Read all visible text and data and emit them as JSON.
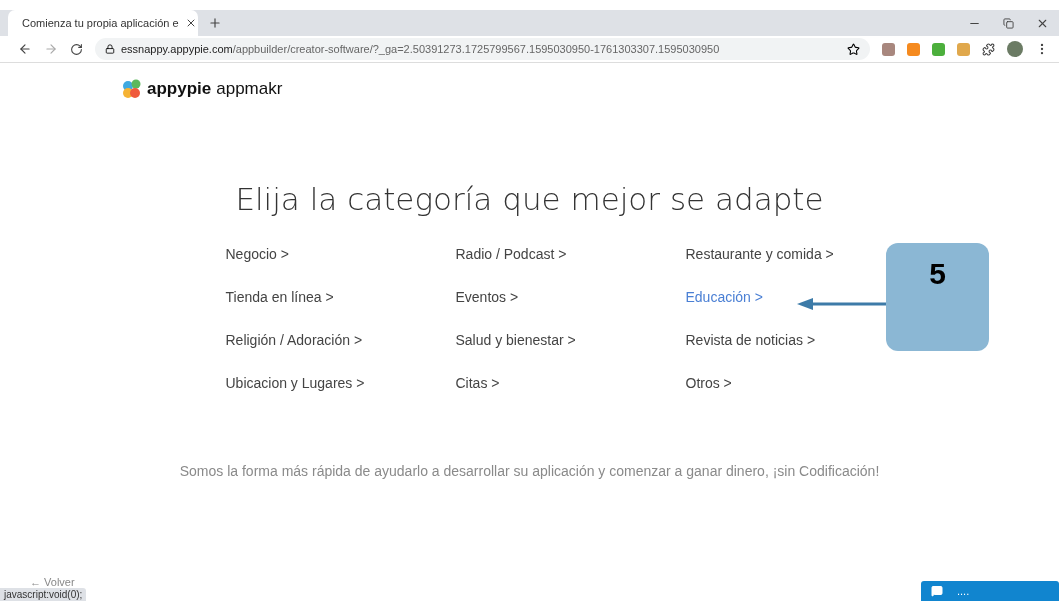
{
  "browser": {
    "tab_title": "Comienza tu propia aplicación e",
    "url_host": "essnappy.appypie.com",
    "url_path": "/appbuilder/creator-software/?_ga=2.50391273.1725799567.1595030950-1761303307.1595030950"
  },
  "logo": {
    "brand": "appypie",
    "product": "appmakr"
  },
  "heading": "Elija la categoría que mejor se adapte",
  "categories": [
    {
      "label": "Negocio >",
      "selected": false
    },
    {
      "label": "Radio / Podcast >",
      "selected": false
    },
    {
      "label": "Restaurante y comida >",
      "selected": false
    },
    {
      "label": "Tienda en línea >",
      "selected": false
    },
    {
      "label": "Eventos >",
      "selected": false
    },
    {
      "label": "Educación >",
      "selected": true
    },
    {
      "label": "Religión / Adoración >",
      "selected": false
    },
    {
      "label": "Salud y bienestar >",
      "selected": false
    },
    {
      "label": "Revista de noticias >",
      "selected": false
    },
    {
      "label": "Ubicacion y Lugares >",
      "selected": false
    },
    {
      "label": "Citas >",
      "selected": false
    },
    {
      "label": "Otros >",
      "selected": false
    }
  ],
  "callout": {
    "number": "5"
  },
  "tagline": "Somos la forma más rápida de ayudarlo a desarrollar su aplicación y comenzar a ganar dinero, ¡sin Codificación!",
  "back_link": "← Volver",
  "status_url": "javascript:void(0);",
  "chat": {
    "label": "...."
  }
}
